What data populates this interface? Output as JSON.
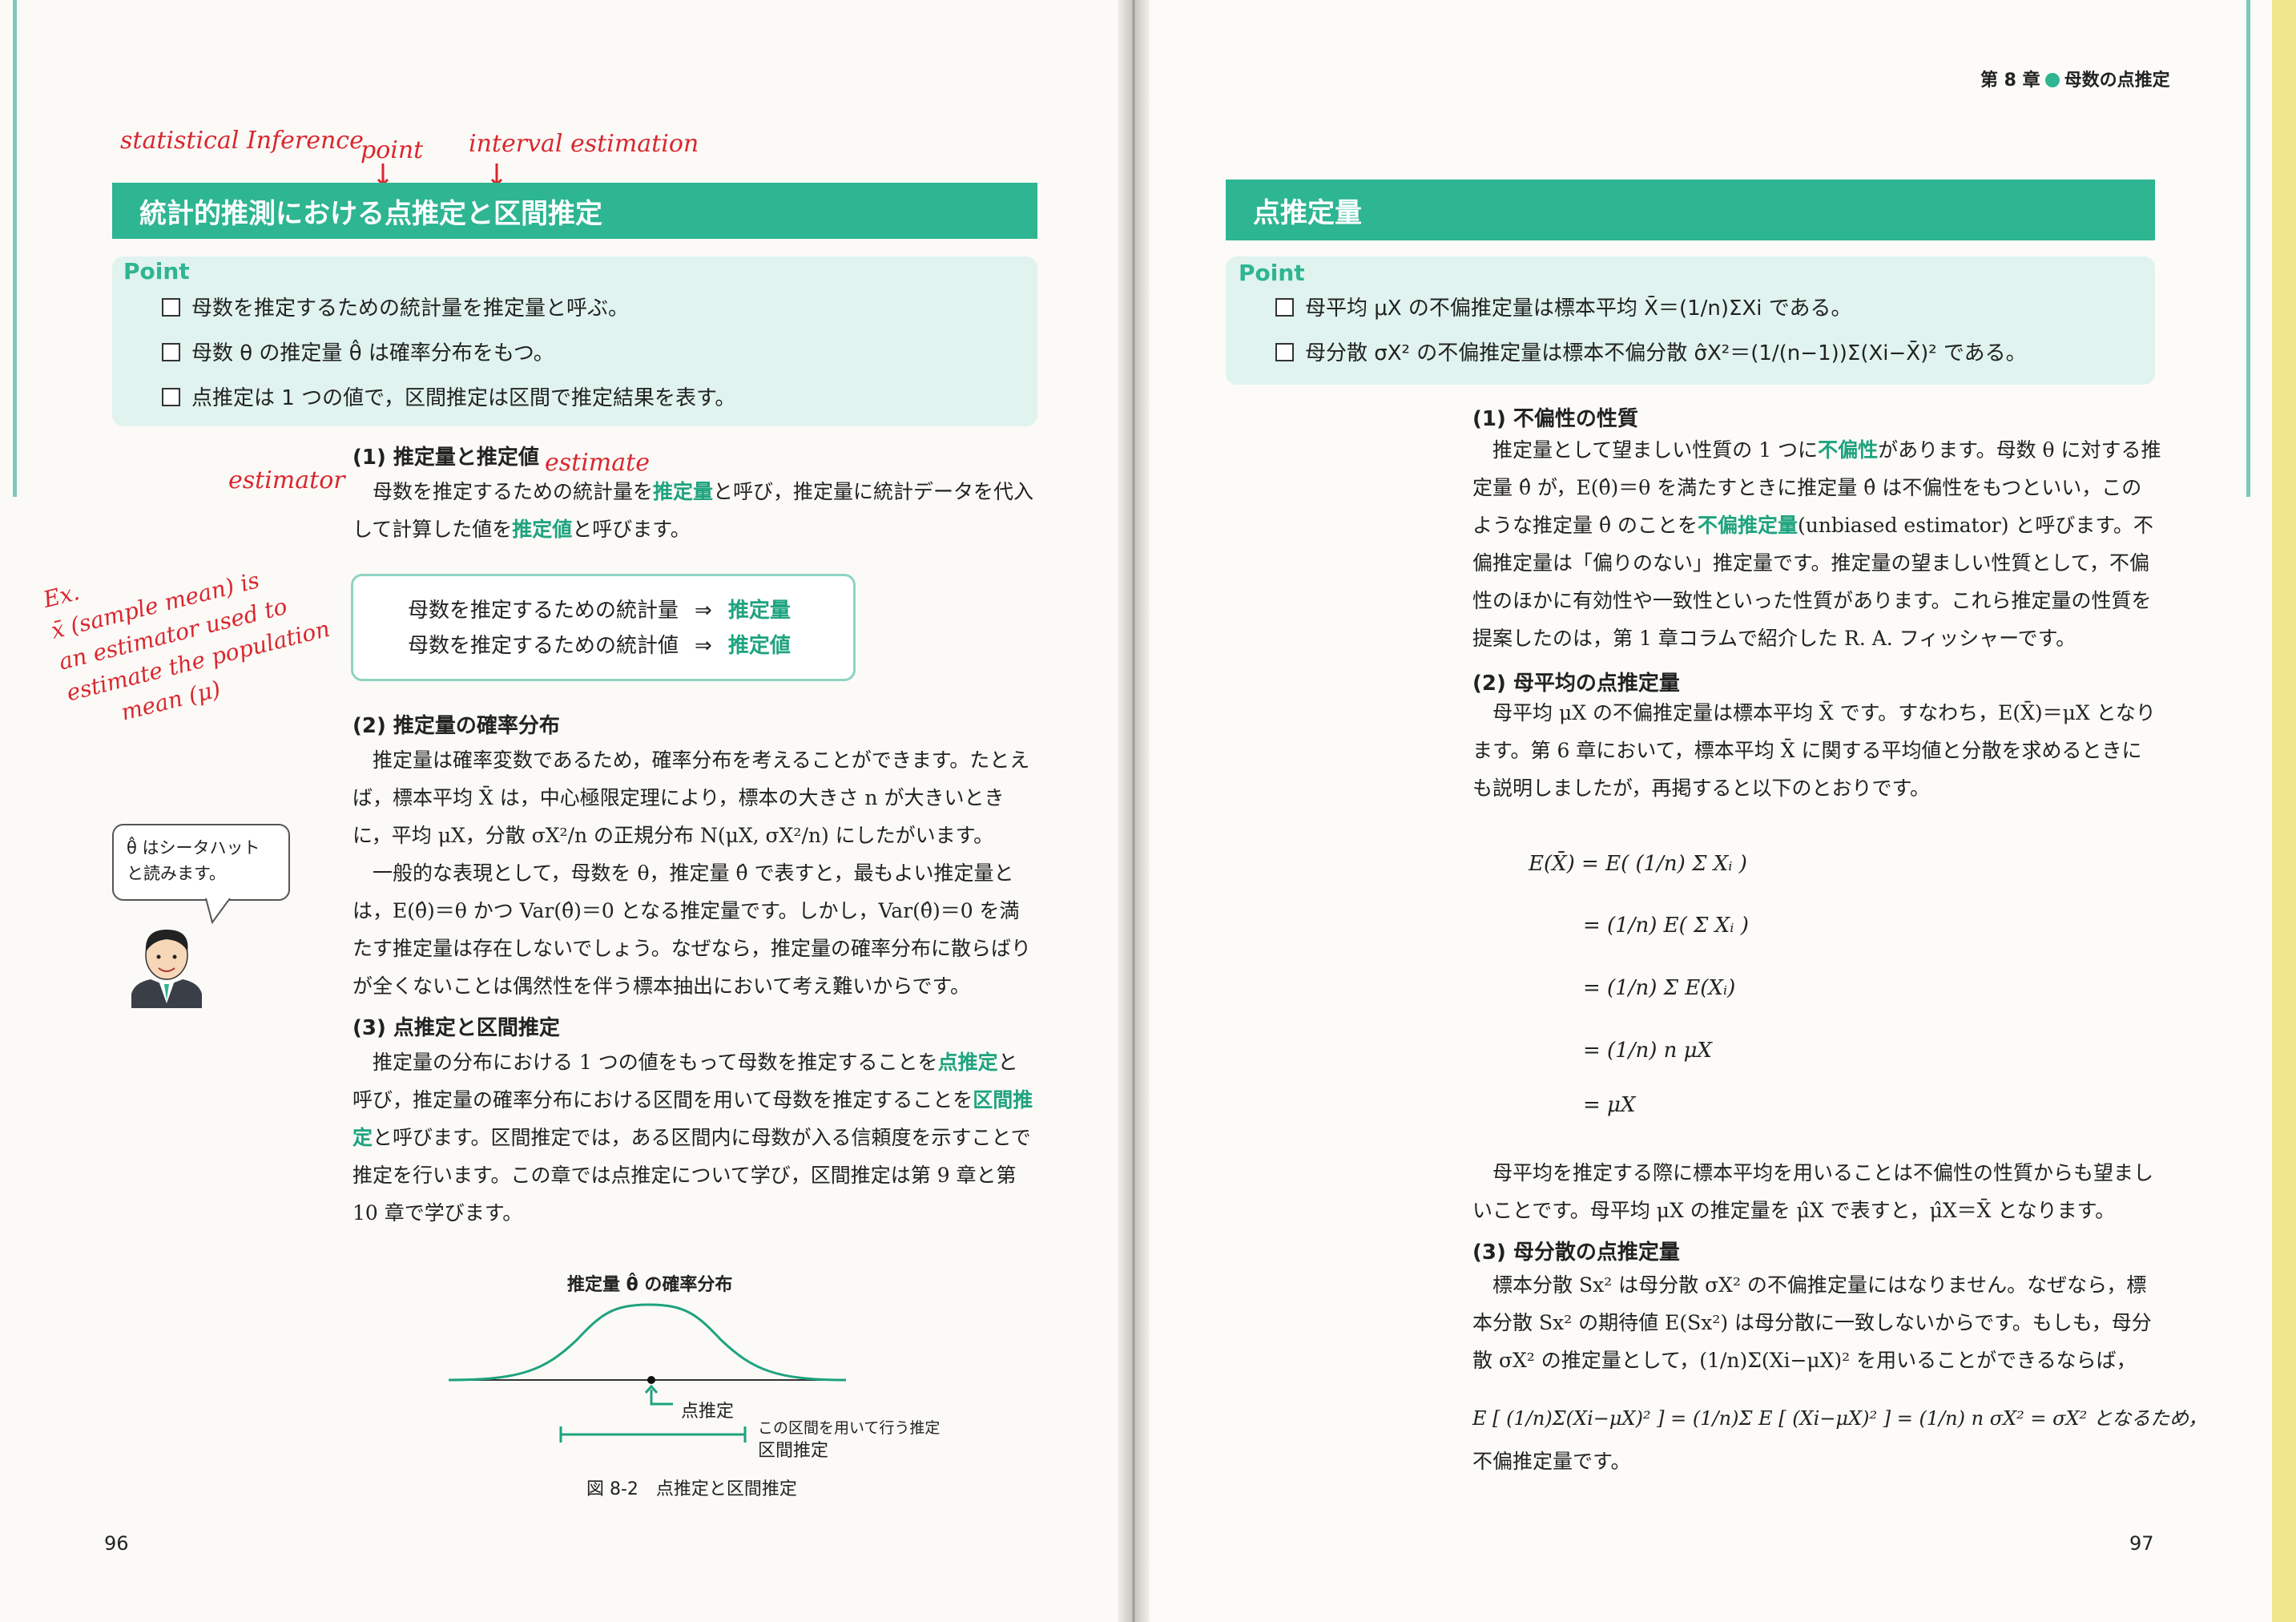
{
  "left": {
    "handnotes": {
      "statistical": "statistical Inference",
      "point": "point",
      "interval": "interval estimation",
      "estimator": "estimator",
      "estimate": "estimate",
      "example": [
        "Ex.",
        "x̄ (sample mean) is",
        "an estimator used to",
        "estimate the population",
        "mean (μ)"
      ]
    },
    "banner": "統計的推測における点推定と区間推定",
    "point_title": "Point",
    "points": [
      "母数を推定するための統計量を推定量と呼ぶ。",
      "母数 θ の推定量 θ̂ は確率分布をもつ。",
      "点推定は 1 つの値で，区間推定は区間で推定結果を表す。"
    ],
    "s1_heading": "(1) 推定量と推定値",
    "s1_body": {
      "a": "母数を推定するための統計量を",
      "b": "推定量",
      "c": "と呼び，推定量に統計データを代入して計算した値を",
      "d": "推定値",
      "e": "と呼びます。"
    },
    "summary": [
      {
        "left": "母数を推定するための統計量",
        "arrow": "⇒",
        "right": "推定量"
      },
      {
        "left": "母数を推定するための統計値",
        "arrow": "⇒",
        "right": "推定値"
      }
    ],
    "s2_heading": "(2) 推定量の確率分布",
    "s2_p1": "推定量は確率変数であるため，確率分布を考えることができます。たとえば，標本平均 X̄ は，中心極限定理により，標本の大きさ n が大きいときに，平均 μX，分散 σX²/n の正規分布 N(μX, σX²/n) にしたがいます。",
    "s2_p2": "一般的な表現として，母数を θ，推定量 θ̂ で表すと，最もよい推定量とは，E(θ̂)＝θ かつ Var(θ̂)＝0 となる推定量です。しかし，Var(θ̂)＝0 を満たす推定量は存在しないでしょう。なぜなら，推定量の確率分布に散らばりが全くないことは偶然性を伴う標本抽出において考え難いからです。",
    "bubble": "θ̂ はシータハットと読みます。",
    "s3_heading": "(3) 点推定と区間推定",
    "s3_body": {
      "a": "推定量の分布における 1 つの値をもって母数を推定することを",
      "b": "点推定",
      "c": "と呼び，推定量の確率分布における区間を用いて母数を推定することを",
      "d": "区間推定",
      "e": "と呼びます。区間推定では，ある区間内に母数が入る信頼度を示すことで推定を行います。この章では点推定について学び，区間推定は第 9 章と第 10 章で学びます。"
    },
    "figure": {
      "title": "推定量 θ̂ の確率分布",
      "point_label": "点推定",
      "interval_label1": "この区間を用いて行う推定",
      "interval_label2": "区間推定",
      "caption": "図 8-2　点推定と区間推定"
    },
    "page_number": "96"
  },
  "right": {
    "running_head_chapter": "第 8 章",
    "running_head_title": "母数の点推定",
    "banner": "点推定量",
    "point_title": "Point",
    "points": [
      "母平均 μX の不偏推定量は標本平均 X̄＝(1/n)ΣXi である。",
      "母分散 σX² の不偏推定量は標本不偏分散 σ̂X²＝(1/(n−1))Σ(Xi−X̄)² である。"
    ],
    "s1_heading": "(1) 不偏性の性質",
    "s1_body": {
      "a": "推定量として望ましい性質の 1 つに",
      "b": "不偏性",
      "c": "があります。母数 θ に対する推定量 θ̂ が，E(θ̂)＝θ を満たすときに推定量 θ̂ は不偏性をもつといい，このような推定量 θ̂ のことを",
      "d": "不偏推定量",
      "e": "(unbiased estimator) と呼びます。不偏推定量は「偏りのない」推定量です。推定量の望ましい性質として，不偏性のほかに有効性や一致性といった性質があります。これら推定量の性質を提案したのは，第 1 章コラムで紹介した R. A. フィッシャーです。"
    },
    "s2_heading": "(2) 母平均の点推定量",
    "s2_body": "母平均 μX の不偏推定量は標本平均 X̄ です。すなわち，E(X̄)＝μX となります。第 6 章において，標本平均 X̄ に関する平均値と分散を求めるときにも説明しましたが，再掲すると以下のとおりです。",
    "equations": [
      "E(X̄) = E( (1/n) Σ Xᵢ )",
      "= (1/n) E( Σ Xᵢ )",
      "= (1/n) Σ E(Xᵢ)",
      "= (1/n) n μX",
      "= μX"
    ],
    "s2_body2": "母平均を推定する際に標本平均を用いることは不偏性の性質からも望ましいことです。母平均 μX の推定量を μ̂X で表すと，μ̂X＝X̄ となります。",
    "s3_heading": "(3) 母分散の点推定量",
    "s3_body": "標本分散 Sx² は母分散 σX² の不偏推定量にはなりません。なぜなら，標本分散 Sx² の期待値 E(Sx²) は母分散に一致しないからです。もしも，母分散 σX² の推定量として，(1/n)Σ(Xi−μX)² を用いることができるならば，",
    "s3_eq": "E [ (1/n)Σ(Xi−μX)² ] = (1/n)Σ E [ (Xi−μX)² ] = (1/n) n σX² = σX² となるため，",
    "s3_end": "不偏推定量です。",
    "page_number": "97"
  }
}
